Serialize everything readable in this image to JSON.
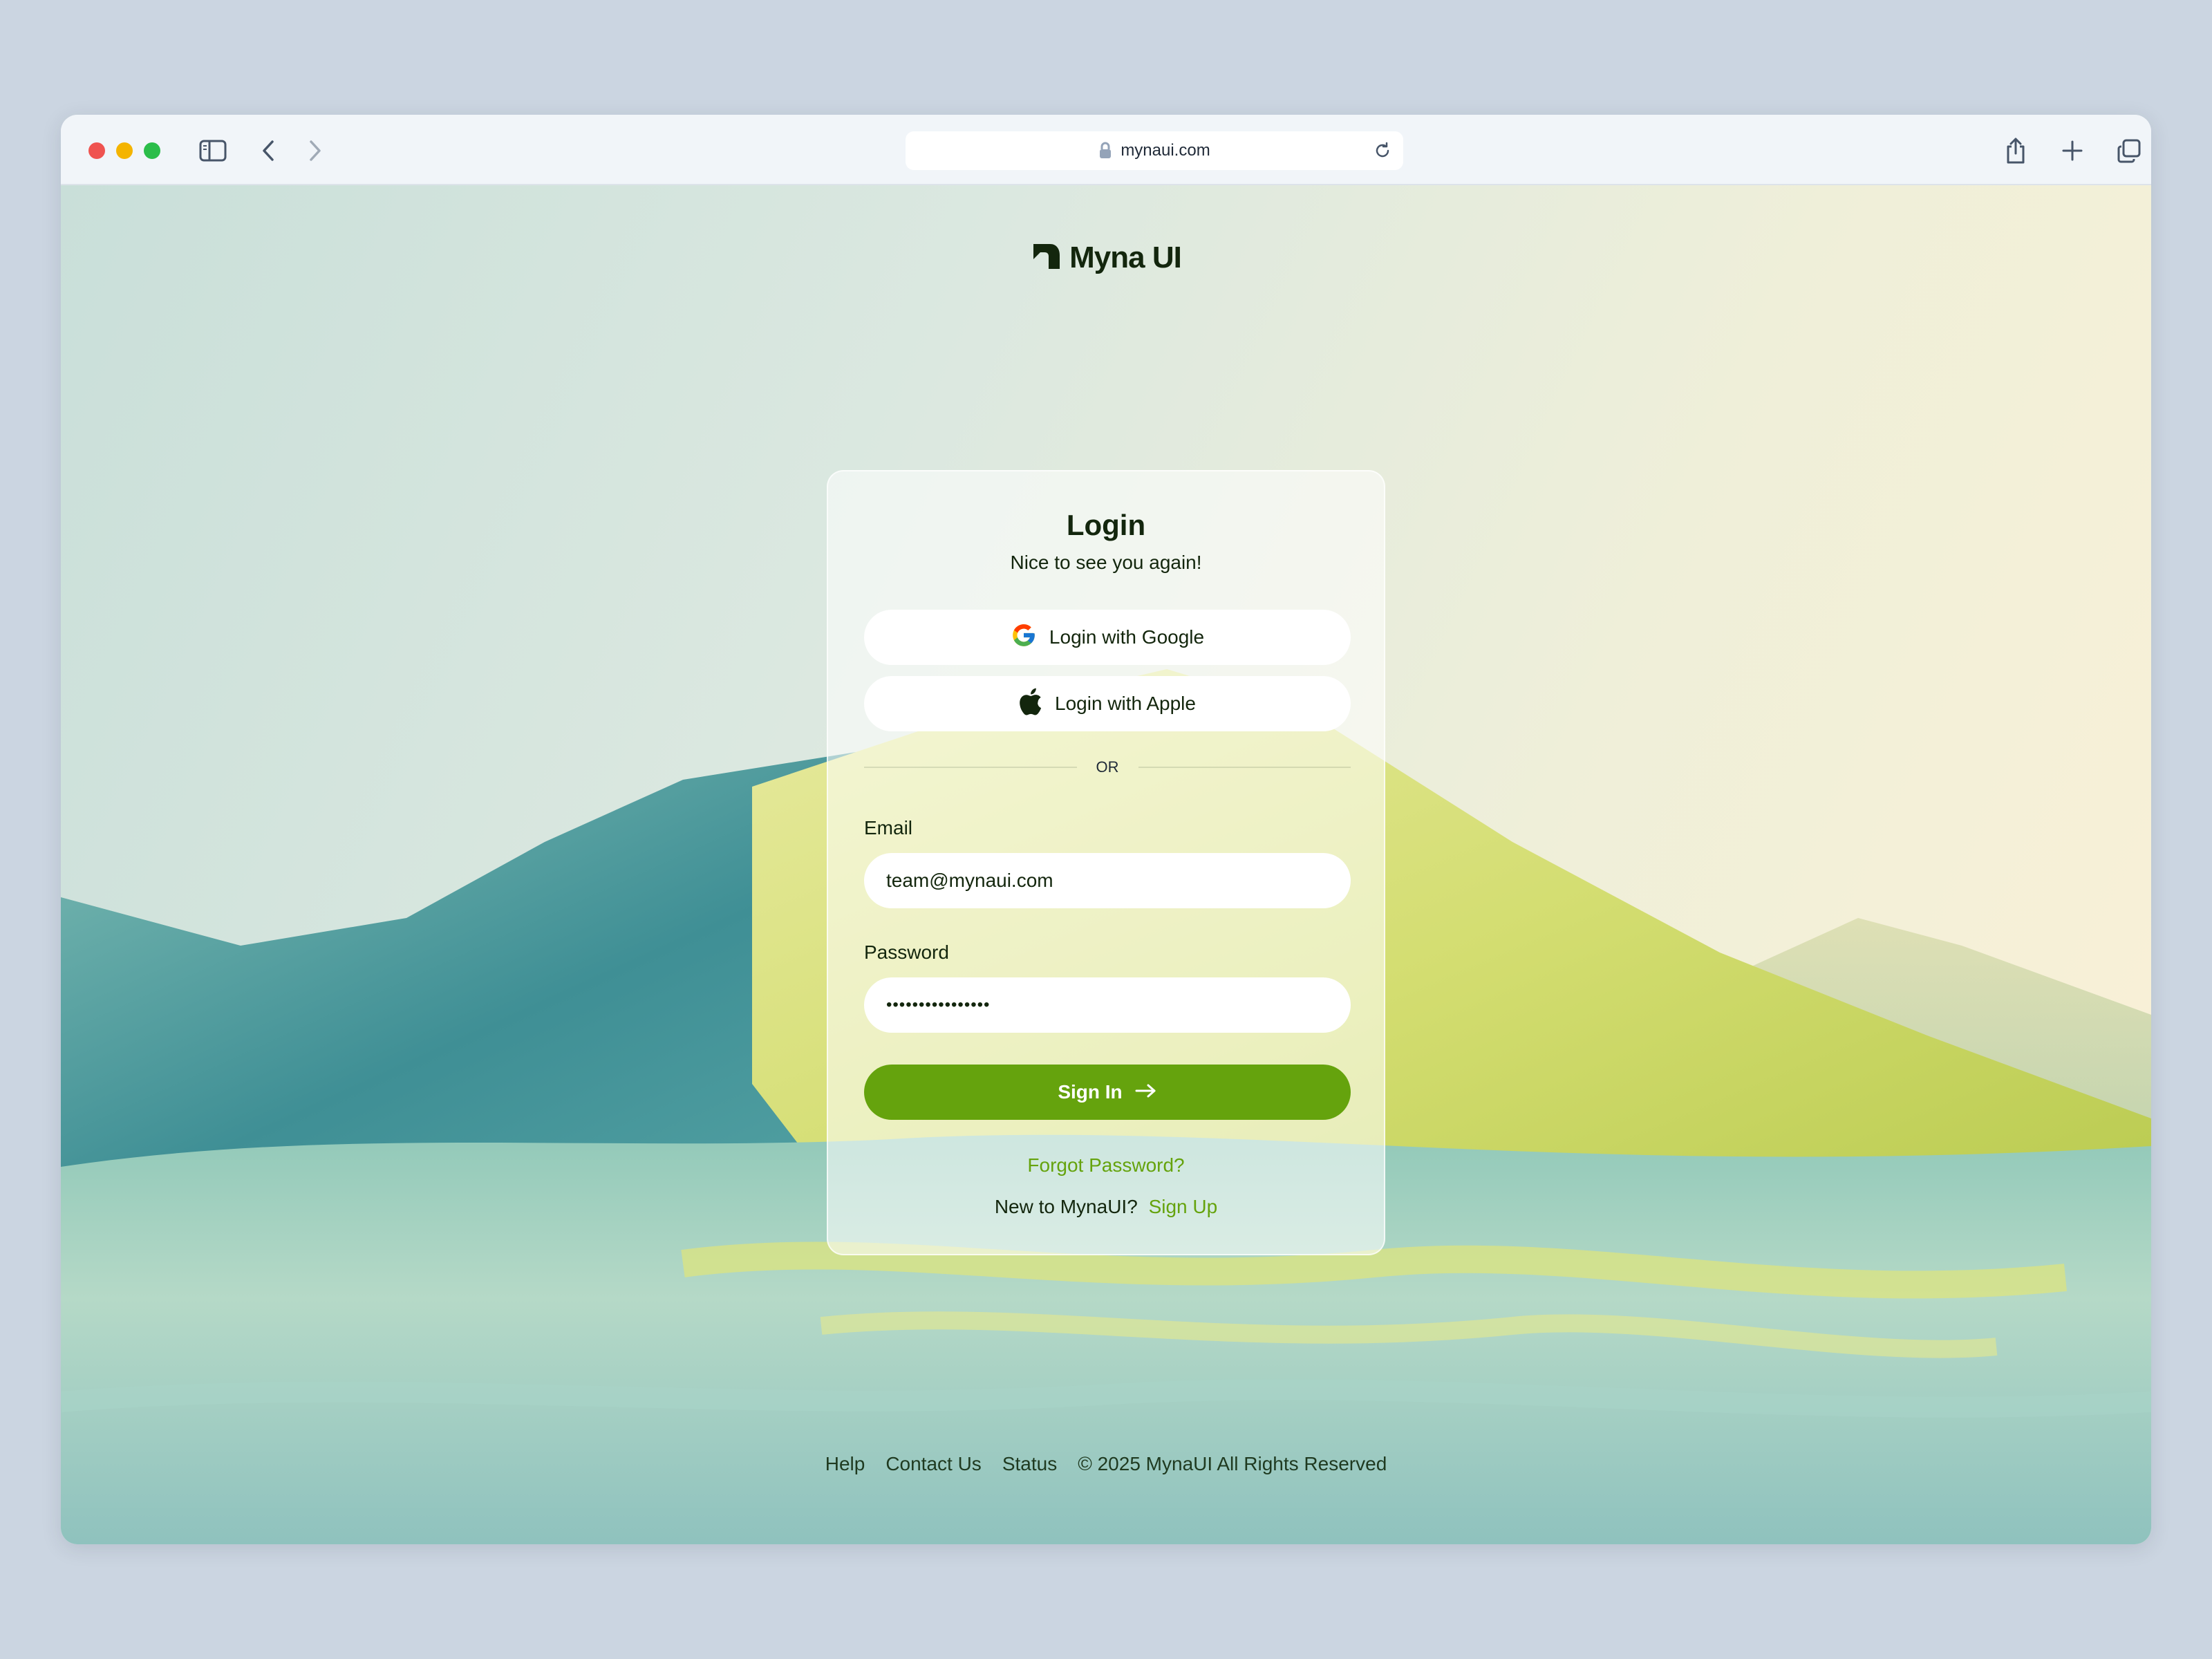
{
  "browser": {
    "url": "mynaui.com",
    "icons": [
      "sidebar-icon",
      "back-icon",
      "forward-icon",
      "lock-icon",
      "reload-icon",
      "share-icon",
      "new-tab-icon",
      "tabs-overview-icon"
    ]
  },
  "brand": {
    "name": "Myna UI"
  },
  "login": {
    "title": "Login",
    "subtitle": "Nice to see you again!",
    "google_label": "Login with Google",
    "apple_label": "Login with Apple",
    "divider_text": "OR",
    "email_label": "Email",
    "email_value": "team@mynaui.com",
    "password_label": "Password",
    "password_value": "••••••••••••••••",
    "signin_label": "Sign In",
    "forgot_label": "Forgot Password?",
    "new_user_text": "New to MynaUI?",
    "signup_label": "Sign Up"
  },
  "footer": {
    "links": [
      "Help",
      "Contact Us",
      "Status"
    ],
    "copyright": "© 2025 MynaUI All Rights Reserved"
  },
  "colors": {
    "accent": "#65a30d",
    "text_dark": "#13260d",
    "outer_bg": "#cbd5e1"
  }
}
